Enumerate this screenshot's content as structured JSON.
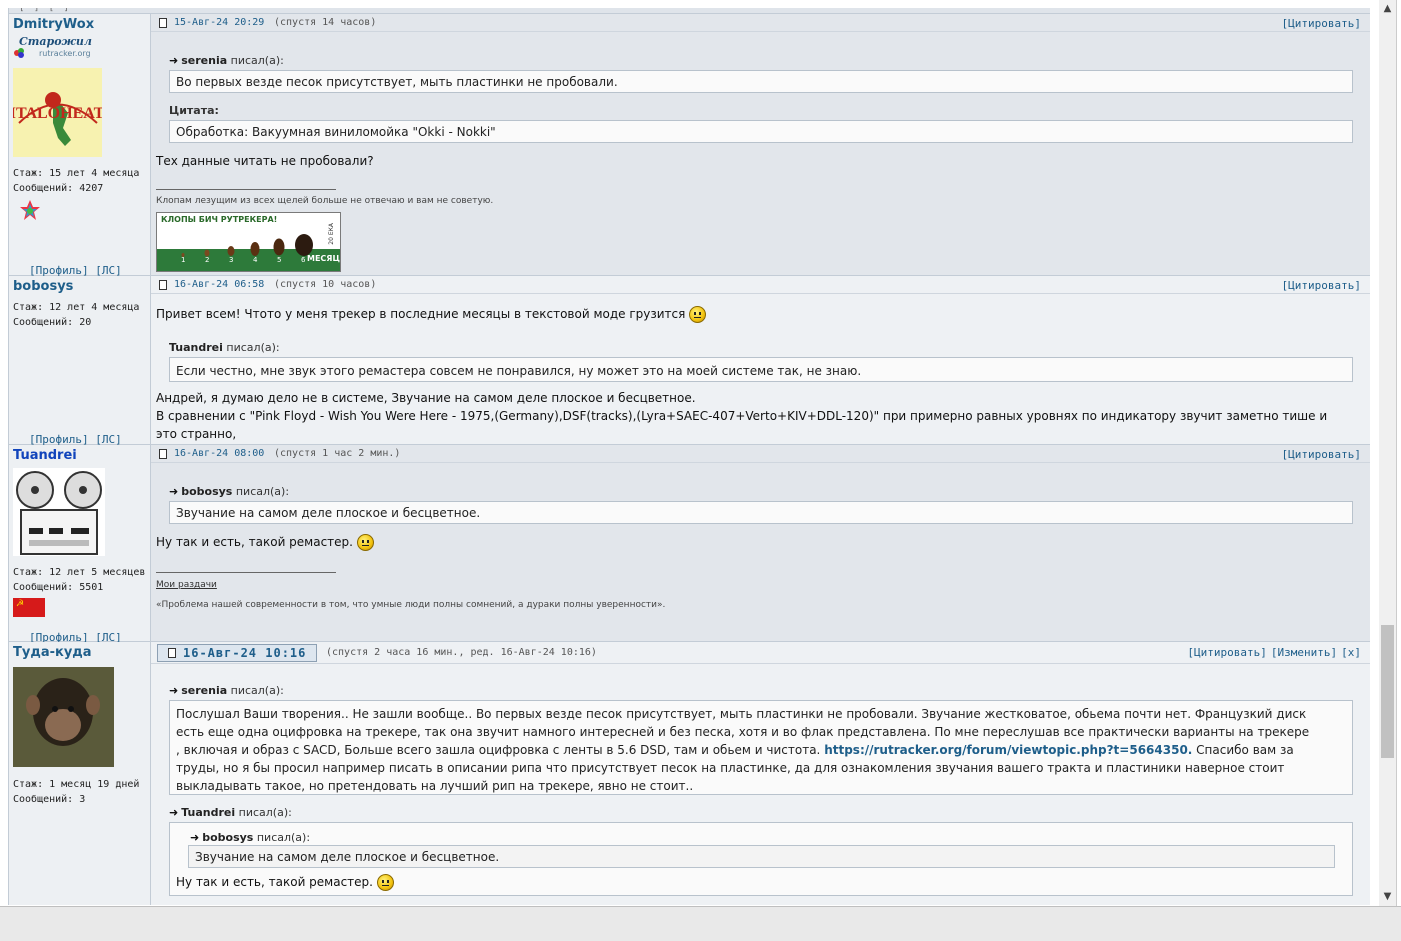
{
  "posts": [
    {
      "nick": "DmitryWox",
      "rank": "Старожил",
      "rank_site": "rutracker.org",
      "stats": [
        "Стаж: 15 лет 4 месяца",
        "Сообщений: 4207"
      ],
      "profile_links": [
        "[Профиль]",
        "[ЛС]"
      ],
      "date": "15-Авг-24 20:29",
      "relative": "(спустя 14 часов)",
      "actions": [
        "[Цитировать]"
      ],
      "quote1_author": "serenia",
      "quote1_text": "Во первых везде песок присутствует, мыть пластинки не пробовали.",
      "quote2_label": "Цитата:",
      "quote2_text": "Обработка: Вакуумная виниломойка \"Okki - Nokki\"",
      "body": "Тех данные читать не пробовали?",
      "signature": "Клопам лезущим из всех щелей больше не отвечаю и вам не советую.",
      "banner_title": "КЛОПЫ БИЧ РУТРЕКЕРА!",
      "banner_scale": [
        "1",
        "2",
        "3",
        "4",
        "5",
        "6"
      ],
      "banner_month": "МЕСЯЦ",
      "banner_side": "20 ЕКА"
    },
    {
      "nick": "bobosys",
      "stats": [
        "Стаж: 12 лет 4 месяца",
        "Сообщений: 20"
      ],
      "profile_links": [
        "[Профиль]",
        "[ЛС]"
      ],
      "date": "16-Авг-24 06:58",
      "relative": "(спустя 10 часов)",
      "actions": [
        "[Цитировать]"
      ],
      "intro": "Привет всем! Чтото у меня трекер в последние месяцы в текстовой моде грузится",
      "quote_author": "Tuandrei",
      "quote_text": "Если честно, мне звук этого ремастера совсем не понравился, ну может это на моей системе так, не знаю.",
      "body_lines": [
        "Андрей, я думаю дело не в системе, Звучание на самом деле плоское и бесцветное.",
        "В сравнении с \"Pink Floyd - Wish You Were Here - 1975,(Germany),DSF(tracks),(Lyra+SAEC-407+Verto+KIV+DDL-120)\" при примерно равных уровнях по индикатору звучит заметно тише и",
        "это странно,"
      ]
    },
    {
      "nick": "Tuandrei",
      "stats": [
        "Стаж: 12 лет 5 месяцев",
        "Сообщений: 5501"
      ],
      "profile_links": [
        "[Профиль]",
        "[ЛС]"
      ],
      "date": "16-Авг-24 08:00",
      "relative": "(спустя 1 час 2 мин.)",
      "actions": [
        "[Цитировать]"
      ],
      "quote_author": "bobosys",
      "quote_text": "Звучание на самом деле плоское и бесцветное.",
      "body": "Ну так и есть, такой ремастер.",
      "sig_link": "Мои раздачи",
      "signature": "«Проблема нашей современности в том, что умные люди полны сомнений, а дураки полны уверенности»."
    },
    {
      "nick": "Туда-куда",
      "stats": [
        "Стаж: 1 месяц 19 дней",
        "Сообщений: 3"
      ],
      "date": "16-Авг-24 10:16",
      "relative": "(спустя 2 часа 16 мин., ред. 16-Авг-24 10:16)",
      "actions": [
        "[Цитировать]",
        "[Изменить]",
        "[x]"
      ],
      "quote1_author": "serenia",
      "quote1_lines": [
        "Послушал Ваши творения.. Не зашли вообще.. Во первых везде песок присутствует, мыть пластинки не пробовали. Звучание жестковатое, обьема почти нет. Французкий диск",
        "есть еще одна оцифровка на трекере, так она звучит намного интересней и без песка, хотя и во флак представлена. По мне переслушав все практически варианты на трекере",
        ", включая и образ с SACD, Больше всего зашла оцифровка с ленты в 5.6 DSD, там и обьем и чистота.",
        " Спасибо вам за",
        "труды, но я бы просил например писать в описании рипа что присутствует песок на пластинке, да для ознакомления звучания вашего тракта и пластиники наверное стоит",
        "выкладывать такое, но претендовать на лучший рип на трекере, явно не стоит.."
      ],
      "quote1_link": "https://rutracker.org/forum/viewtopic.php?t=5664350.",
      "quote2_author": "Tuandrei",
      "nested_author": "bobosys",
      "nested_text": "Звучание на самом деле плоское и бесцветное.",
      "quote2_body": "Ну так и есть, такой ремастер."
    }
  ],
  "wrote_label": "писал(а):"
}
